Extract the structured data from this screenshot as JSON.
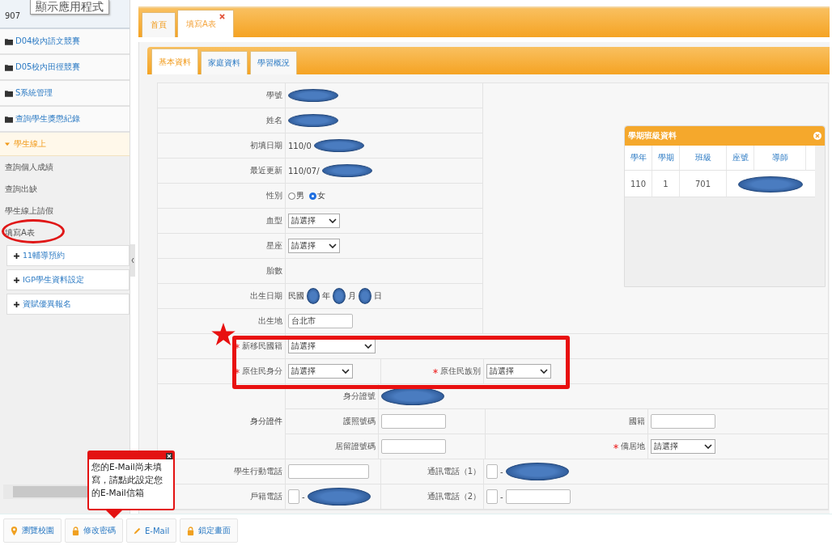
{
  "header": {
    "account": "907",
    "tooltip": "顯示應用程式"
  },
  "sidebar": {
    "folders": [
      {
        "label": "D04校內語文競賽"
      },
      {
        "label": "D05校內田徑競賽"
      },
      {
        "label": "S系統管理"
      },
      {
        "label": "查詢學生獎懲紀錄"
      }
    ],
    "section": {
      "label": "學生線上",
      "expanded": true,
      "items": [
        {
          "label": "查詢個人成績",
          "circled": false
        },
        {
          "label": "查詢出缺",
          "circled": false
        },
        {
          "label": "學生線上請假",
          "circled": false
        },
        {
          "label": "填寫A表",
          "circled": true
        }
      ]
    },
    "links": [
      {
        "label": "11輔導預約"
      },
      {
        "label": "IGP學生資料設定"
      },
      {
        "label": "資賦優異報名"
      }
    ]
  },
  "tabs": [
    {
      "label": "首頁",
      "selected": false,
      "closable": false
    },
    {
      "label": "填寫A表",
      "selected": true,
      "closable": true
    }
  ],
  "subtabs": [
    {
      "label": "基本資料",
      "selected": true
    },
    {
      "label": "家庭資料",
      "selected": false
    },
    {
      "label": "學習概況",
      "selected": false
    }
  ],
  "form": {
    "top_rows": [
      {
        "label": "學號",
        "field": {
          "kind": "text",
          "redacted": true
        }
      },
      {
        "label": "姓名",
        "field": {
          "kind": "text",
          "redacted": true
        }
      },
      {
        "label": "初填日期",
        "field": {
          "kind": "text",
          "value": "110/0",
          "redacted": true
        }
      },
      {
        "label": "最近更新",
        "field": {
          "kind": "text",
          "value": "110/07/",
          "redacted": true
        }
      },
      {
        "label": "性別",
        "field": {
          "kind": "radio",
          "options": [
            {
              "label": "男",
              "selected": false
            },
            {
              "label": "女",
              "selected": true
            }
          ]
        }
      },
      {
        "label": "血型",
        "field": {
          "kind": "select",
          "value": "請選擇"
        }
      },
      {
        "label": "星座",
        "field": {
          "kind": "select",
          "value": "請選擇"
        }
      },
      {
        "label": "胎數"
      },
      {
        "label": "出生日期",
        "field": {
          "kind": "date",
          "prefix": "民國",
          "parts": [
            {
              "unit": "年",
              "redacted": true
            },
            {
              "unit": "月",
              "redacted": true
            },
            {
              "unit": "日",
              "redacted": true
            }
          ]
        }
      },
      {
        "label": "出生地",
        "field": {
          "kind": "input",
          "value": "台北市"
        }
      }
    ],
    "class_panel": {
      "title": "學期班級資料",
      "columns": [
        "學年",
        "學期",
        "班級",
        "座號",
        "導師"
      ],
      "rows": [
        {
          "cells": [
            "110",
            "1",
            "701"
          ],
          "redacted": true
        }
      ]
    },
    "highlight": {
      "starred": true,
      "rows": [
        {
          "cells": [
            {
              "label": "新移民國籍",
              "required": true,
              "field": {
                "kind": "select",
                "value": "請選擇"
              }
            }
          ]
        },
        {
          "cells": [
            {
              "label": "原住民身分",
              "required": true,
              "field": {
                "kind": "select",
                "value": "請選擇"
              }
            },
            {
              "label": "原住民族別",
              "required": true,
              "field": {
                "kind": "select",
                "value": "請選擇"
              }
            }
          ]
        }
      ]
    },
    "id_group": {
      "label": "身分證件",
      "rows": [
        {
          "cells": [
            {
              "label": "身分證號",
              "field": {
                "kind": "input",
                "redacted": true
              }
            }
          ]
        },
        {
          "cells": [
            {
              "label": "護照號碼",
              "field": {
                "kind": "input"
              }
            },
            {
              "label": "國籍",
              "field": {
                "kind": "input"
              }
            }
          ]
        },
        {
          "cells": [
            {
              "label": "居留證號碼",
              "field": {
                "kind": "input"
              }
            },
            {
              "label": "僑居地",
              "required": true,
              "field": {
                "kind": "select",
                "value": "請選擇"
              }
            }
          ]
        }
      ]
    },
    "phone_rows": [
      {
        "cells": [
          {
            "label": "學生行動電話",
            "field": {
              "kind": "input"
            }
          },
          {
            "label": "通訊電話（1）",
            "field": {
              "kind": "phone",
              "separator": "-",
              "redacted": true
            }
          }
        ]
      },
      {
        "cells": [
          {
            "label": "戶籍電話",
            "field": {
              "kind": "phone",
              "separator": "-",
              "redacted": true
            }
          },
          {
            "label": "通訊電話（2）",
            "field": {
              "kind": "phone",
              "separator": "-",
              "redacted": false
            }
          }
        ]
      }
    ]
  },
  "popup": {
    "text": "您的E-Mail尚未填寫，請點此設定您的E-Mail信箱"
  },
  "footer_buttons": [
    {
      "label": "瀏覽校園",
      "kind": "pin"
    },
    {
      "label": "修改密碼",
      "kind": "lock"
    },
    {
      "label": "E-Mail",
      "kind": "pencil"
    },
    {
      "label": "鎖定畫面",
      "kind": "lock"
    }
  ]
}
